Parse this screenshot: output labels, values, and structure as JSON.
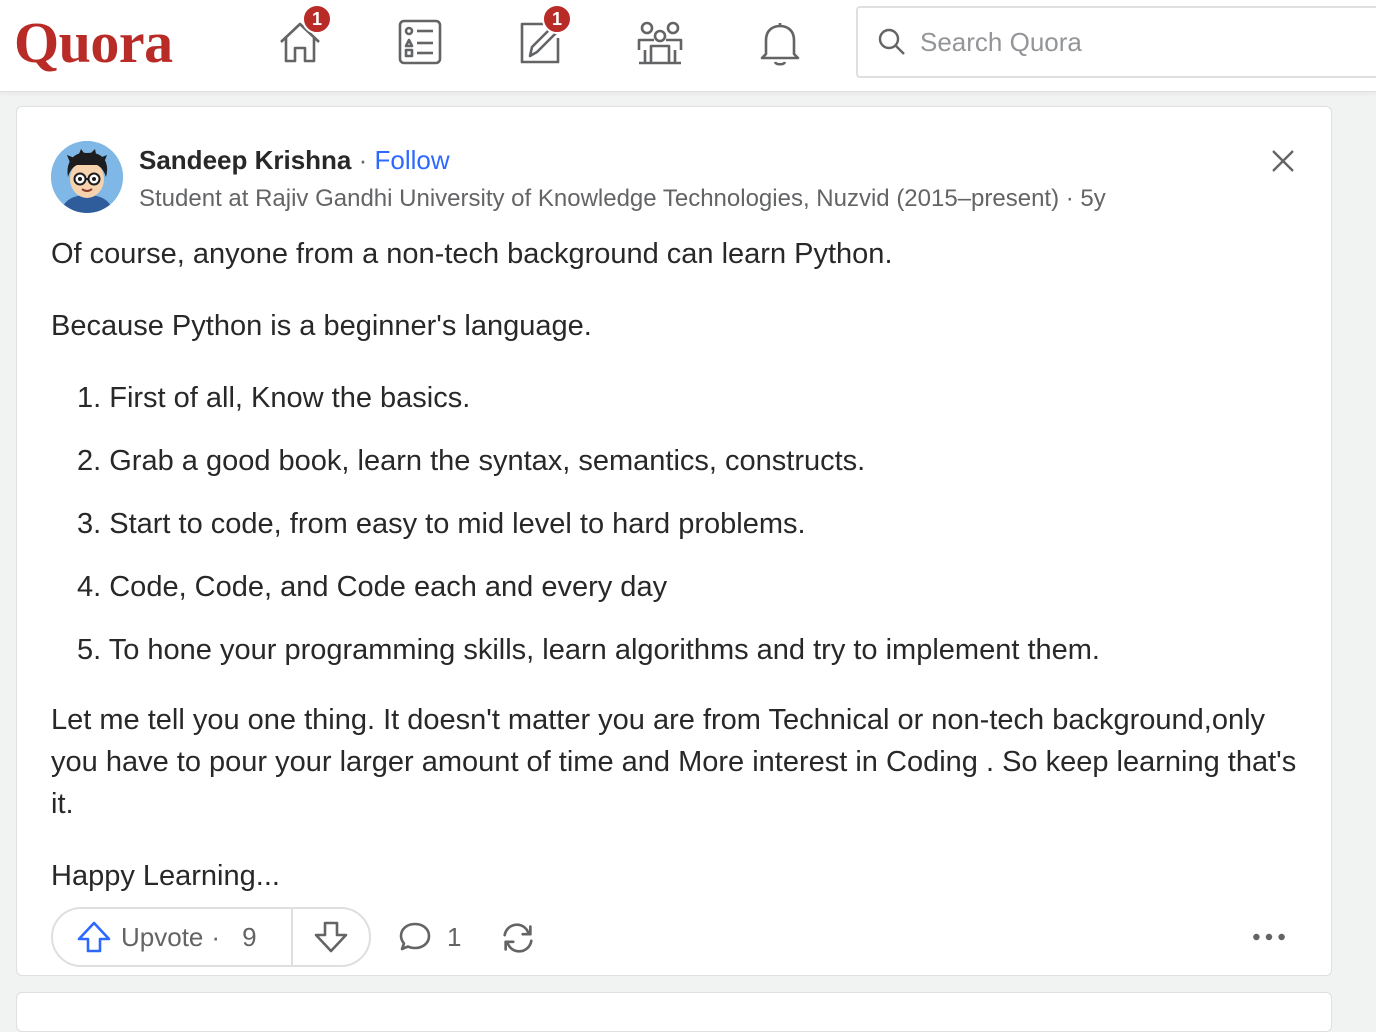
{
  "header": {
    "logo": "Quora",
    "nav": [
      {
        "name": "home-icon",
        "badge": "1"
      },
      {
        "name": "following-icon",
        "badge": ""
      },
      {
        "name": "answer-icon",
        "badge": "1"
      },
      {
        "name": "spaces-icon",
        "badge": ""
      },
      {
        "name": "bell-icon",
        "badge": ""
      }
    ],
    "search": {
      "placeholder": "Search Quora",
      "value": ""
    }
  },
  "answer": {
    "author": {
      "name": "Sandeep Krishna",
      "separator": " · ",
      "follow_label": "Follow",
      "credential": "Student at Rajiv Gandhi University of Knowledge Technologies, Nuzvid (2015–present) · 5y"
    },
    "paragraphs": [
      "Of course, anyone from a non-tech background can learn Python.",
      "Because Python is a beginner's language."
    ],
    "list": [
      "1. First of all, Know the basics.",
      "2. Grab a good book, learn the syntax, semantics, constructs.",
      "3. Start to code, from easy to mid level to hard problems.",
      "4. Code, Code, and Code each and every day",
      "5. To hone your programming skills, learn algorithms and try to implement them."
    ],
    "closing": [
      "Let me tell you one thing. It doesn't matter you are from Technical or non-tech background,only you have to pour your larger amount of time and More interest in Coding . So keep learning that's it.",
      "Happy Learning..."
    ],
    "actions": {
      "upvote_label": "Upvote",
      "upvote_sep": "·",
      "upvote_count": "9",
      "comment_count": "1"
    }
  },
  "colors": {
    "brand": "#b92b27",
    "link": "#2e69ff",
    "text": "#282829",
    "muted": "#636466"
  }
}
